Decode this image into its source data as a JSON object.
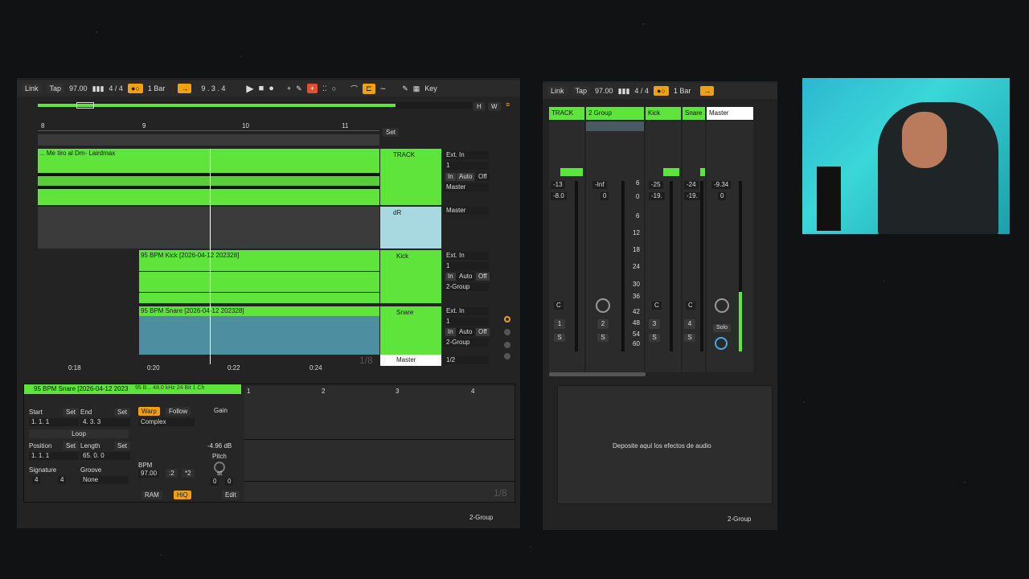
{
  "colors": {
    "accent_green": "#5fe43c",
    "accent_orange": "#f0a010",
    "bg": "#232323"
  },
  "arr": {
    "transport": {
      "link": "Link",
      "tap": "Tap",
      "tempo": "97.00",
      "sig": "4 / 4",
      "quant": "1 Bar",
      "position": "9 .  3 .  4",
      "key": "Key"
    },
    "ruler": {
      "marks": [
        "8",
        "9",
        "10",
        "11"
      ],
      "set": "Set"
    },
    "time": [
      "0:18",
      "0:20",
      "0:22",
      "0:24"
    ],
    "hw": [
      "H",
      "W"
    ],
    "tracks": [
      {
        "clip": "... Me tiro al Dm- Lairdmax",
        "name": "TRACK",
        "in": "Ext. In",
        "ch": "1",
        "mon": [
          "In",
          "Auto",
          "Off"
        ],
        "out": "Master"
      },
      {
        "clip": "",
        "name": "dR",
        "out": "Master"
      },
      {
        "clip": "95 BPM Kick [2026-04-12 202328]",
        "name": "Kick",
        "in": "Ext. In",
        "ch": "1",
        "mon": [
          "In",
          "Auto",
          "Off"
        ],
        "out": "2-Group"
      },
      {
        "clip": "95 BPM Snare [2026-04-12 202328]",
        "name": "Snare",
        "in": "Ext. In",
        "ch": "1",
        "mon": [
          "In",
          "Auto",
          "Off"
        ],
        "out": "2-Group"
      }
    ],
    "master": {
      "name": "Master",
      "val": "1/2"
    },
    "frac": "1/8"
  },
  "clipview": {
    "title": "95 BPM Snare [2026-04-12 2023",
    "info": "95 B...  48.0 kHz  24 Bit  1 Ch",
    "start": "Start",
    "end": "End",
    "set": "Set",
    "start_val": "1.   1.   1",
    "end_val": "4.   3.   3",
    "loop": "Loop",
    "position": "Position",
    "length": "Length",
    "pos_val": "1.   1.   1",
    "len_val": "65.   0.   0",
    "signature": "Signature",
    "groove": "Groove",
    "sig_num": "4",
    "sig_den": "4",
    "groove_val": "None",
    "warp": "Warp",
    "follow": "Follow",
    "mode": "Complex",
    "gain": "Gain",
    "gain_val": "-4.96 dB",
    "pitch": "Pitch",
    "st": "st",
    "pitch_vals": [
      "0",
      "0"
    ],
    "bpm": "BPM",
    "bpm_val": "97.00",
    "half": ":2",
    "double": "*2",
    "ram": "RAM",
    "hiq": "HiQ",
    "edit": "Edit",
    "ruler": [
      "1",
      "2",
      "3",
      "4"
    ],
    "frac": "1/8",
    "bottom": "2-Group"
  },
  "mixer": {
    "transport": {
      "link": "Link",
      "tap": "Tap",
      "tempo": "97.00",
      "sig": "4 / 4",
      "quant": "1 Bar"
    },
    "tabs": [
      "TRACK",
      "2 Group",
      "Kick",
      "Snare",
      "Master"
    ],
    "master_num": "1",
    "volumes": [
      [
        "-13",
        "-8.0"
      ],
      [
        "-Inf",
        "0"
      ],
      [
        "-25",
        "-19."
      ],
      [
        "-24",
        "-19."
      ],
      [
        "-9.34",
        "0"
      ]
    ],
    "scale": [
      "6",
      "0",
      "6",
      "12",
      "18",
      "24",
      "30",
      "36",
      "42",
      "48",
      "54",
      "60"
    ],
    "cvals": [
      "C",
      "C",
      "C"
    ],
    "nums": [
      "1",
      "2",
      "3",
      "4"
    ],
    "s": "S",
    "solo": "Solo",
    "effects": "Deposite aquí los efectos de audio",
    "bottom": "2-Group"
  }
}
